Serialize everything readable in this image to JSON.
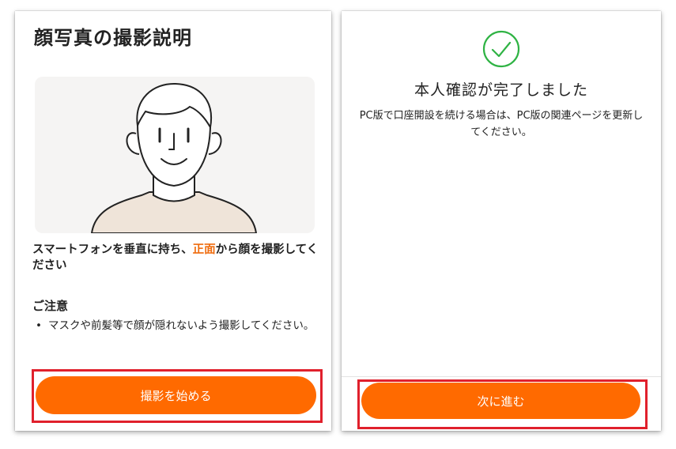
{
  "left_screen": {
    "title": "顔写真の撮影説明",
    "instruction_before": "スマートフォンを垂直に持ち、",
    "instruction_highlight": "正面",
    "instruction_after": "から顔を撮影してください",
    "note_heading": "ご注意",
    "note_items": [
      "マスクや前髪等で顔が隠れないよう撮影してください。"
    ],
    "button_label": "撮影を始める"
  },
  "right_screen": {
    "status_title": "本人確認が完了しました",
    "description": "PC版で口座開設を続ける場合は、PC版の関連ページを更新してください。",
    "button_label": "次に進む"
  },
  "colors": {
    "accent": "#ff6a00",
    "highlight_text": "#ef6c0e",
    "success": "#2fb344",
    "annotation_box": "#e0202c"
  },
  "icons": {
    "success": "check-circle-icon",
    "illustration": "face-illustration"
  }
}
